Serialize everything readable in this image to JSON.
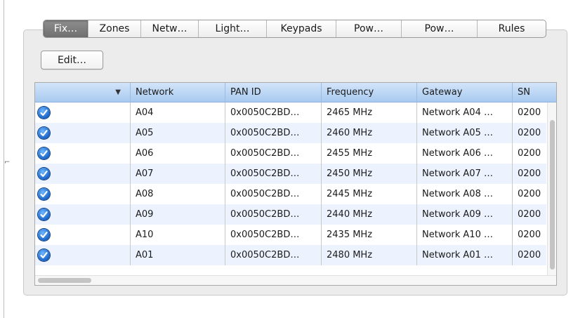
{
  "tabs": [
    {
      "label": "Fix…",
      "selected": true
    },
    {
      "label": "Zones",
      "selected": false
    },
    {
      "label": "Netw…",
      "selected": false
    },
    {
      "label": "Light…",
      "selected": false
    },
    {
      "label": "Keypads",
      "selected": false
    },
    {
      "label": "Pow…",
      "selected": false
    },
    {
      "label": "Pow…",
      "selected": false
    },
    {
      "label": "Rules",
      "selected": false
    }
  ],
  "toolbar": {
    "edit_label": "Edit…"
  },
  "table": {
    "columns": [
      "",
      "Network",
      "PAN ID",
      "Frequency",
      "Gateway",
      "SN"
    ],
    "rows": [
      {
        "checked": true,
        "network": "A04",
        "pan_id": "0x0050C2BD…",
        "frequency": "2465 MHz",
        "gateway": "Network A04 …",
        "sn": "0200"
      },
      {
        "checked": true,
        "network": "A05",
        "pan_id": "0x0050C2BD…",
        "frequency": "2460 MHz",
        "gateway": "Network A05 …",
        "sn": "0200"
      },
      {
        "checked": true,
        "network": "A06",
        "pan_id": "0x0050C2BD…",
        "frequency": "2455 MHz",
        "gateway": "Network A06 …",
        "sn": "0200"
      },
      {
        "checked": true,
        "network": "A07",
        "pan_id": "0x0050C2BD…",
        "frequency": "2450 MHz",
        "gateway": "Network A07 …",
        "sn": "0200"
      },
      {
        "checked": true,
        "network": "A08",
        "pan_id": "0x0050C2BD…",
        "frequency": "2445 MHz",
        "gateway": "Network A08 …",
        "sn": "0200"
      },
      {
        "checked": true,
        "network": "A09",
        "pan_id": "0x0050C2BD…",
        "frequency": "2440 MHz",
        "gateway": "Network A09 …",
        "sn": "0200"
      },
      {
        "checked": true,
        "network": "A10",
        "pan_id": "0x0050C2BD…",
        "frequency": "2435 MHz",
        "gateway": "Network A10 …",
        "sn": "0200"
      },
      {
        "checked": true,
        "network": "A01",
        "pan_id": "0x0050C2BD…",
        "frequency": "2480 MHz",
        "gateway": "Network A01 …",
        "sn": "0200"
      }
    ]
  },
  "icons": {
    "check": "checkmark-circle-icon",
    "sort": "sort-descending-icon"
  },
  "colors": {
    "header": "#a8caf0",
    "alt_row": "#edf3fe",
    "check": "#1a64c7",
    "selected_tab": "#7a7a7a"
  }
}
